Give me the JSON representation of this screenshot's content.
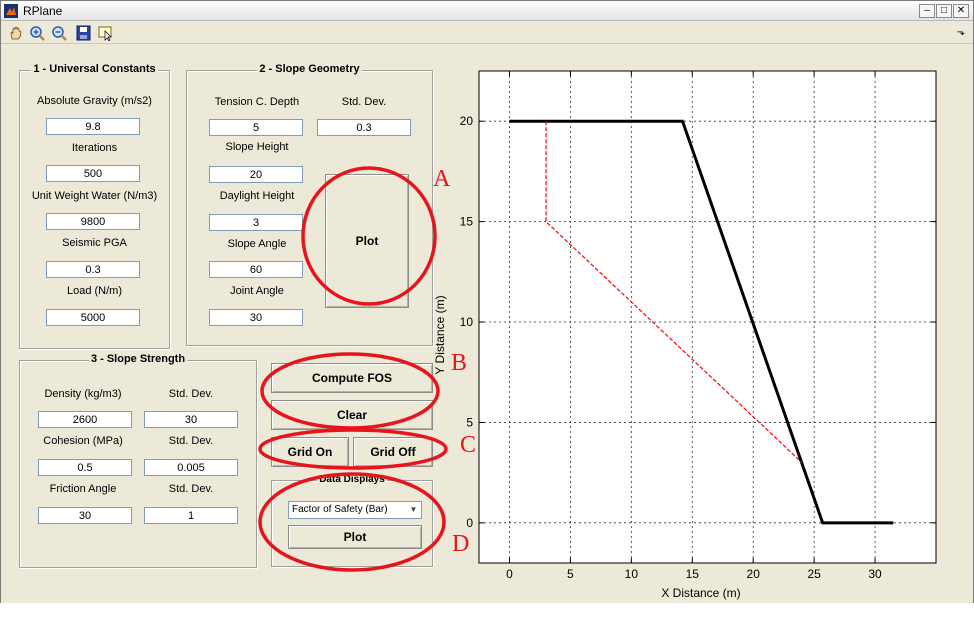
{
  "window": {
    "title": "RPlane"
  },
  "panels": {
    "constants": {
      "title": "1 - Universal Constants",
      "gravity_label": "Absolute Gravity (m/s2)",
      "gravity_value": "9.8",
      "iterations_label": "Iterations",
      "iterations_value": "500",
      "water_label": "Unit Weight Water (N/m3)",
      "water_value": "9800",
      "pga_label": "Seismic PGA",
      "pga_value": "0.3",
      "load_label": "Load (N/m)",
      "load_value": "5000"
    },
    "geometry": {
      "title": "2 - Slope Geometry",
      "tension_label": "Tension C. Depth",
      "tension_value": "5",
      "stddev_label": "Std. Dev.",
      "stddev_value": "0.3",
      "height_label": "Slope Height",
      "height_value": "20",
      "daylight_label": "Daylight Height",
      "daylight_value": "3",
      "angle_label": "Slope Angle",
      "angle_value": "60",
      "joint_label": "Joint Angle",
      "joint_value": "30",
      "plot_label": "Plot"
    },
    "strength": {
      "title": "3 - Slope Strength",
      "density_label": "Density (kg/m3)",
      "density_value": "2600",
      "density_std_label": "Std. Dev.",
      "density_std_value": "30",
      "cohesion_label": "Cohesion (MPa)",
      "cohesion_value": "0.5",
      "cohesion_std_label": "Std. Dev.",
      "cohesion_std_value": "0.005",
      "friction_label": "Friction Angle",
      "friction_value": "30",
      "friction_std_label": "Std. Dev.",
      "friction_std_value": "1"
    },
    "actions": {
      "compute_label": "Compute FOS",
      "clear_label": "Clear",
      "grid_on_label": "Grid On",
      "grid_off_label": "Grid Off"
    },
    "displays": {
      "title": "Data Displays",
      "selected": "Factor of Safety (Bar)",
      "plot_label": "Plot"
    }
  },
  "annotations": {
    "a": "A",
    "b": "B",
    "c": "C",
    "d": "D",
    "color": "#e8141b"
  },
  "icons": [
    "hand-icon",
    "zoom-in-icon",
    "zoom-out-icon",
    "save-icon",
    "data-cursor-icon"
  ],
  "chart_data": {
    "type": "line",
    "xlabel": "X Distance (m)",
    "ylabel": "Y Distance (m)",
    "xlim": [
      -2.5,
      35
    ],
    "ylim": [
      -2,
      22.5
    ],
    "xticks": [
      0,
      5,
      10,
      15,
      20,
      25,
      30
    ],
    "yticks": [
      0,
      5,
      10,
      15,
      20
    ],
    "grid": true,
    "series": [
      {
        "style": "solid",
        "color": "#000000",
        "x": [
          0,
          14.2,
          25.7,
          31.5
        ],
        "y": [
          20,
          20,
          0,
          0
        ]
      },
      {
        "style": "dashed",
        "color": "#ff0000",
        "x": [
          3,
          3,
          24
        ],
        "y": [
          20,
          15,
          3
        ]
      }
    ]
  }
}
